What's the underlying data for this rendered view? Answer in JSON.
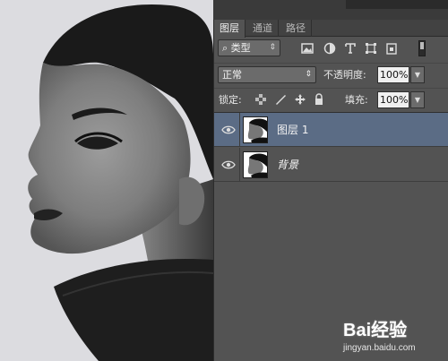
{
  "panel": {
    "tabs": [
      {
        "label": "图层",
        "active": true
      },
      {
        "label": "通道",
        "active": false
      },
      {
        "label": "路径",
        "active": false
      }
    ],
    "filter": {
      "kind_label": "类型",
      "search_glyph": "⌕"
    },
    "filter_icons": [
      "image-filter-icon",
      "adjustment-filter-icon",
      "type-filter-icon",
      "shape-filter-icon",
      "smart-object-filter-icon"
    ],
    "blend": {
      "mode": "正常",
      "opacity_label": "不透明度:",
      "opacity_value": "100%"
    },
    "lock": {
      "label": "锁定:",
      "fill_label": "填充:",
      "fill_value": "100%"
    },
    "layers": [
      {
        "name": "图层 1",
        "selected": true,
        "italic": false
      },
      {
        "name": "背景",
        "selected": false,
        "italic": true
      }
    ],
    "colors": {
      "panel_bg": "#535353",
      "selection": "#5b6c85"
    }
  },
  "watermark": {
    "brand": "Bai经验",
    "url": "jingyan.baidu.com"
  }
}
